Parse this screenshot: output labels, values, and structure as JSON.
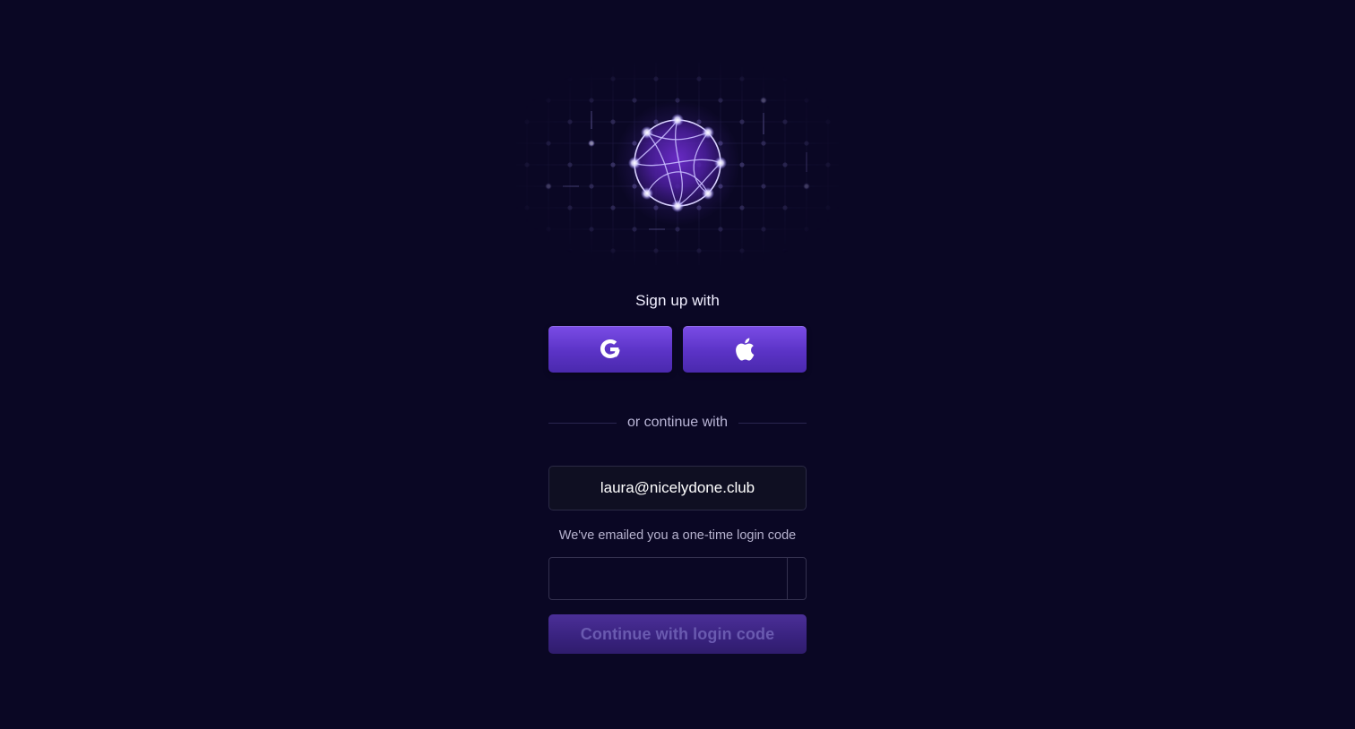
{
  "signup": {
    "title": "Sign up with",
    "google_icon": "google-icon",
    "apple_icon": "apple-icon"
  },
  "divider": {
    "text": "or continue with"
  },
  "email": {
    "value": "laura@nicelydone.club"
  },
  "notice": {
    "text": "We've emailed you a one-time login code"
  },
  "code": {
    "cells": [
      "",
      "",
      "",
      "",
      "",
      ""
    ]
  },
  "continue": {
    "label": "Continue with login code",
    "enabled": false
  },
  "colors": {
    "background": "#0a0724",
    "accent": "#6b3ee0"
  }
}
